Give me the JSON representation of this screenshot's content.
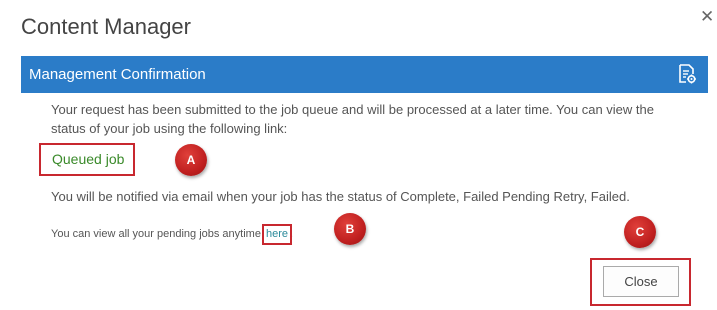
{
  "dialog": {
    "title": "Content Manager",
    "close_icon": "✕"
  },
  "banner": {
    "title": "Management Confirmation",
    "icon": "document-settings-icon",
    "color": "#2b7cc8"
  },
  "message": {
    "line1": "Your request has been submitted to the job queue and will be processed at a later time. You can view the status of your job using the following link:",
    "queued_link": "Queued job",
    "notify": "You will be notified via email when your job has the status of Complete, Failed Pending Retry, Failed.",
    "pending_prefix": "You can view all your pending jobs anytime ",
    "pending_link": "here",
    "pending_suffix": "."
  },
  "markers": {
    "a": "A",
    "b": "B",
    "c": "C"
  },
  "buttons": {
    "close": "Close"
  }
}
